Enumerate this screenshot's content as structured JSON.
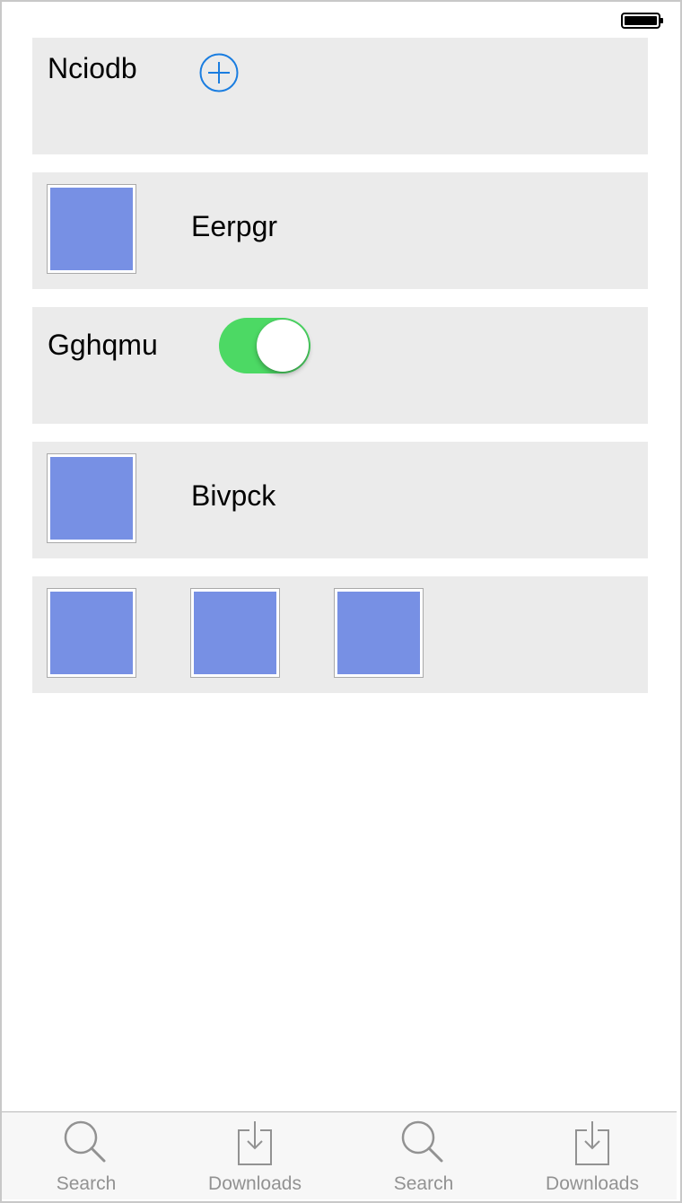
{
  "status_bar": {
    "battery_icon": "battery-full-icon"
  },
  "cards": {
    "nciodb": {
      "label": "Nciodb",
      "add_icon": "plus-circle-icon"
    },
    "eerpgr": {
      "label": "Eerpgr"
    },
    "gghqmu": {
      "label": "Gghqmu",
      "toggle_on": true
    },
    "bivpck": {
      "label": "Bivpck"
    },
    "gallery": {
      "image_count": 3
    }
  },
  "tabbar": {
    "tabs": [
      {
        "label": "Search",
        "icon": "search-icon"
      },
      {
        "label": "Downloads",
        "icon": "download-icon"
      },
      {
        "label": "Search",
        "icon": "search-icon"
      },
      {
        "label": "Downloads",
        "icon": "download-icon"
      }
    ]
  },
  "colors": {
    "card_bg": "#ebebeb",
    "image_placeholder": "#7790e4",
    "toggle_on": "#4cd964",
    "accent_blue": "#1a7de0",
    "tab_inactive": "#929292"
  }
}
